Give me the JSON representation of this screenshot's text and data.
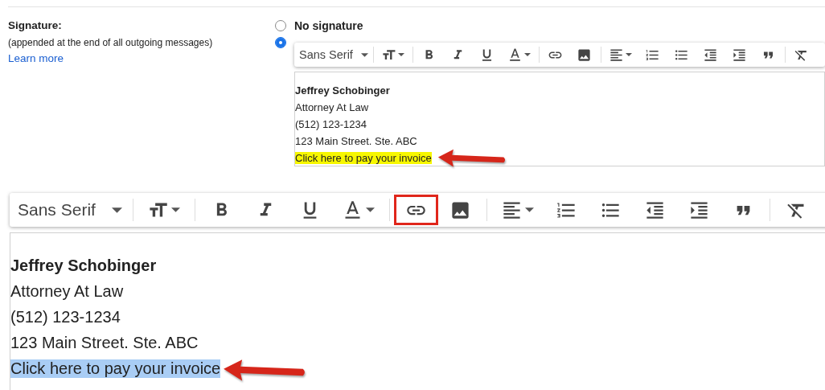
{
  "signature": {
    "label": "Signature:",
    "hint": "(appended at the end of all outgoing messages)",
    "link": "Learn more"
  },
  "options": [
    {
      "label": "No signature",
      "selected": false
    },
    {
      "selected": true
    }
  ],
  "editors": [
    {
      "compact": true,
      "font": "Sans Serif",
      "tools": [
        [
          {
            "kind": "size",
            "outlined": false
          }
        ],
        [
          {
            "kind": "bold",
            "outlined": false
          },
          {
            "kind": "italic",
            "outlined": false
          },
          {
            "kind": "underline",
            "outlined": false
          },
          {
            "kind": "color",
            "outlined": false
          }
        ],
        [
          {
            "kind": "link",
            "outlined": false
          },
          {
            "kind": "image",
            "outlined": false
          }
        ],
        [
          {
            "kind": "align",
            "outlined": false
          },
          {
            "kind": "numbered",
            "outlined": false
          },
          {
            "kind": "bulleted",
            "outlined": false
          },
          {
            "kind": "outdent",
            "outlined": false
          },
          {
            "kind": "indent",
            "outlined": false
          },
          {
            "kind": "quote",
            "outlined": false
          }
        ],
        [
          {
            "kind": "clear",
            "outlined": false
          }
        ]
      ],
      "lines": [
        {
          "text": "Jeffrey Schobinger",
          "bold": true,
          "highlighted": false,
          "arrow": false
        },
        {
          "text": "Attorney At Law",
          "bold": false,
          "highlighted": false,
          "arrow": false
        },
        {
          "text": "(512) 123-1234",
          "bold": false,
          "highlighted": false,
          "arrow": false
        },
        {
          "text": "123 Main Street. Ste. ABC",
          "bold": false,
          "highlighted": false,
          "arrow": false
        },
        {
          "text": "Click here to pay your invoice",
          "bold": false,
          "highlighted": true,
          "arrow": true
        }
      ]
    },
    {
      "compact": false,
      "font": "Sans Serif",
      "tools": [
        [
          {
            "kind": "size",
            "outlined": false
          }
        ],
        [
          {
            "kind": "bold",
            "outlined": false
          },
          {
            "kind": "italic",
            "outlined": false
          },
          {
            "kind": "underline",
            "outlined": false
          },
          {
            "kind": "color",
            "outlined": false
          }
        ],
        [
          {
            "kind": "link",
            "outlined": true
          },
          {
            "kind": "image",
            "outlined": false
          }
        ],
        [
          {
            "kind": "align",
            "outlined": false
          },
          {
            "kind": "numbered",
            "outlined": false
          },
          {
            "kind": "bulleted",
            "outlined": false
          },
          {
            "kind": "outdent",
            "outlined": false
          },
          {
            "kind": "indent",
            "outlined": false
          },
          {
            "kind": "quote",
            "outlined": false
          }
        ],
        [
          {
            "kind": "clear",
            "outlined": false
          }
        ]
      ],
      "lines": [
        {
          "text": "Jeffrey Schobinger",
          "bold": true,
          "selected": false,
          "arrow": false
        },
        {
          "text": "Attorney At Law",
          "bold": false,
          "selected": false,
          "arrow": false
        },
        {
          "text": "(512) 123-1234",
          "bold": false,
          "selected": false,
          "arrow": false
        },
        {
          "text": "123 Main Street. Ste. ABC",
          "bold": false,
          "selected": false,
          "arrow": false
        },
        {
          "text": "Click here to pay your invoice",
          "bold": false,
          "selected": true,
          "arrow": true
        }
      ]
    }
  ]
}
